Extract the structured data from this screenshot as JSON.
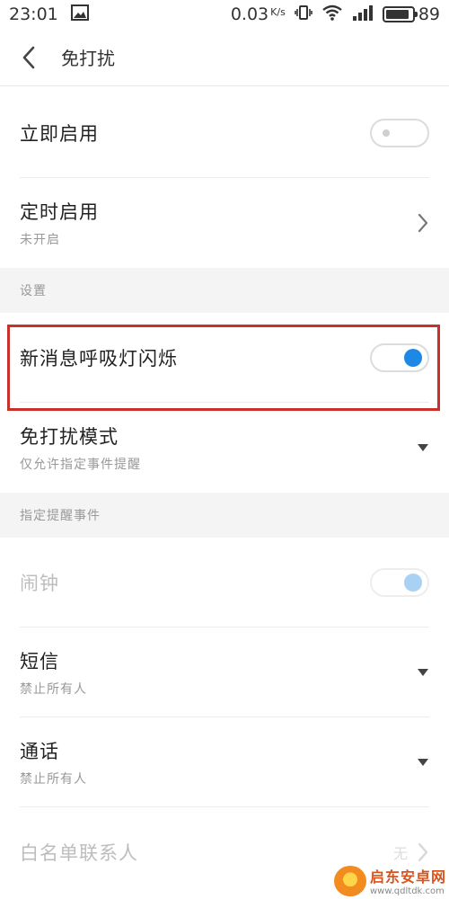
{
  "status_bar": {
    "time": "23:01",
    "net_speed": "0.03",
    "net_unit": "K/s",
    "battery_level": "89",
    "icons": [
      "image-icon",
      "vibrate-icon",
      "wifi-icon",
      "signal-icon",
      "battery-icon"
    ]
  },
  "app_bar": {
    "title": "免打扰"
  },
  "rows": {
    "immediate": {
      "title": "立即启用",
      "toggle": "off"
    },
    "scheduled": {
      "title": "定时启用",
      "subtitle": "未开启"
    },
    "breathing_light": {
      "title": "新消息呼吸灯闪烁",
      "toggle": "on"
    },
    "dnd_mode": {
      "title": "免打扰模式",
      "subtitle": "仅允许指定事件提醒"
    },
    "alarm": {
      "title": "闹钟",
      "toggle": "on-disabled"
    },
    "sms": {
      "title": "短信",
      "subtitle": "禁止所有人"
    },
    "call": {
      "title": "通话",
      "subtitle": "禁止所有人"
    },
    "whitelist": {
      "title": "白名单联系人",
      "value": "无"
    }
  },
  "sections": {
    "settings": "设置",
    "events": "指定提醒事件"
  },
  "watermark": {
    "title": "启东安卓网",
    "url": "www.qdltdk.com"
  },
  "colors": {
    "accent": "#1e88e5",
    "highlight": "#c8312b",
    "section_bg": "#f4f4f4"
  }
}
